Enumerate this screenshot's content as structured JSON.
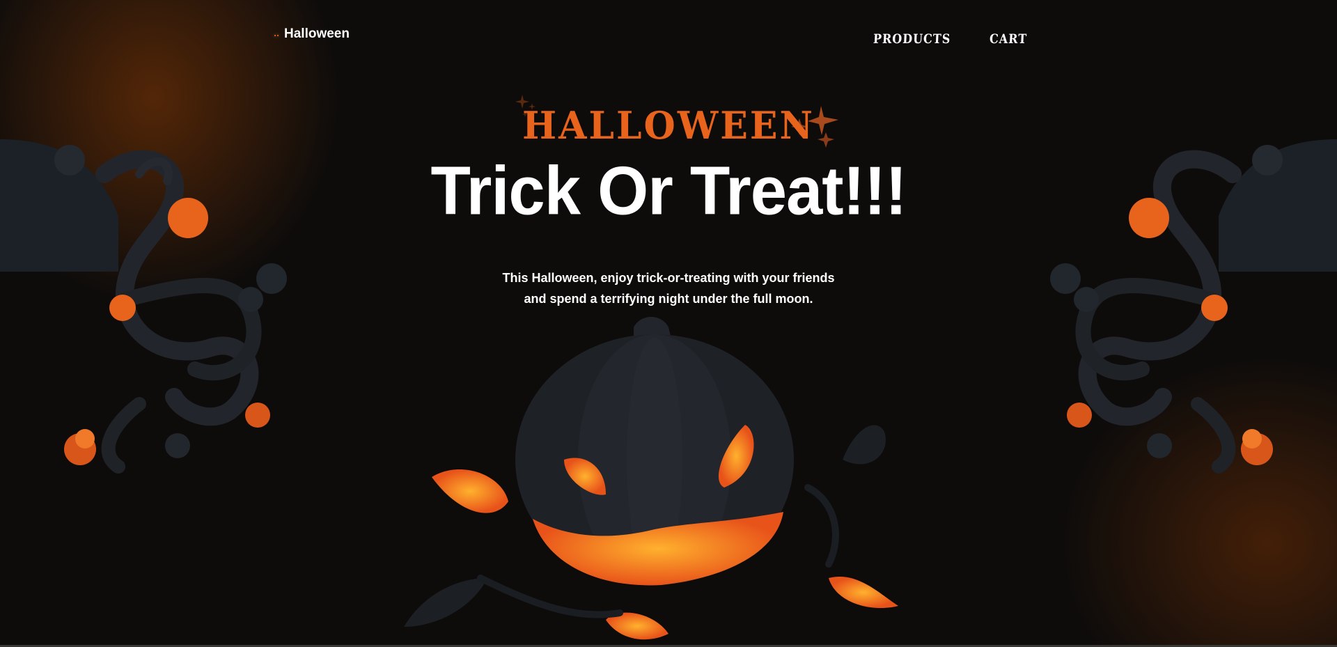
{
  "header": {
    "brand": "Halloween",
    "nav": [
      {
        "label": "Products"
      },
      {
        "label": "Cart"
      }
    ]
  },
  "hero": {
    "kicker": "HALLOWEEN",
    "title": "Trick Or Treat!!!",
    "subtitle_line1": "This Halloween, enjoy trick-or-treating with your friends",
    "subtitle_line2": "and spend a terrifying night under the full moon."
  },
  "colors": {
    "background": "#0e0c0b",
    "accent_orange": "#e8631c",
    "text": "#ffffff"
  },
  "icons": [
    "pumpkin-logo-icon",
    "star-icon",
    "pumpkin-illustration",
    "branch-illustration"
  ]
}
